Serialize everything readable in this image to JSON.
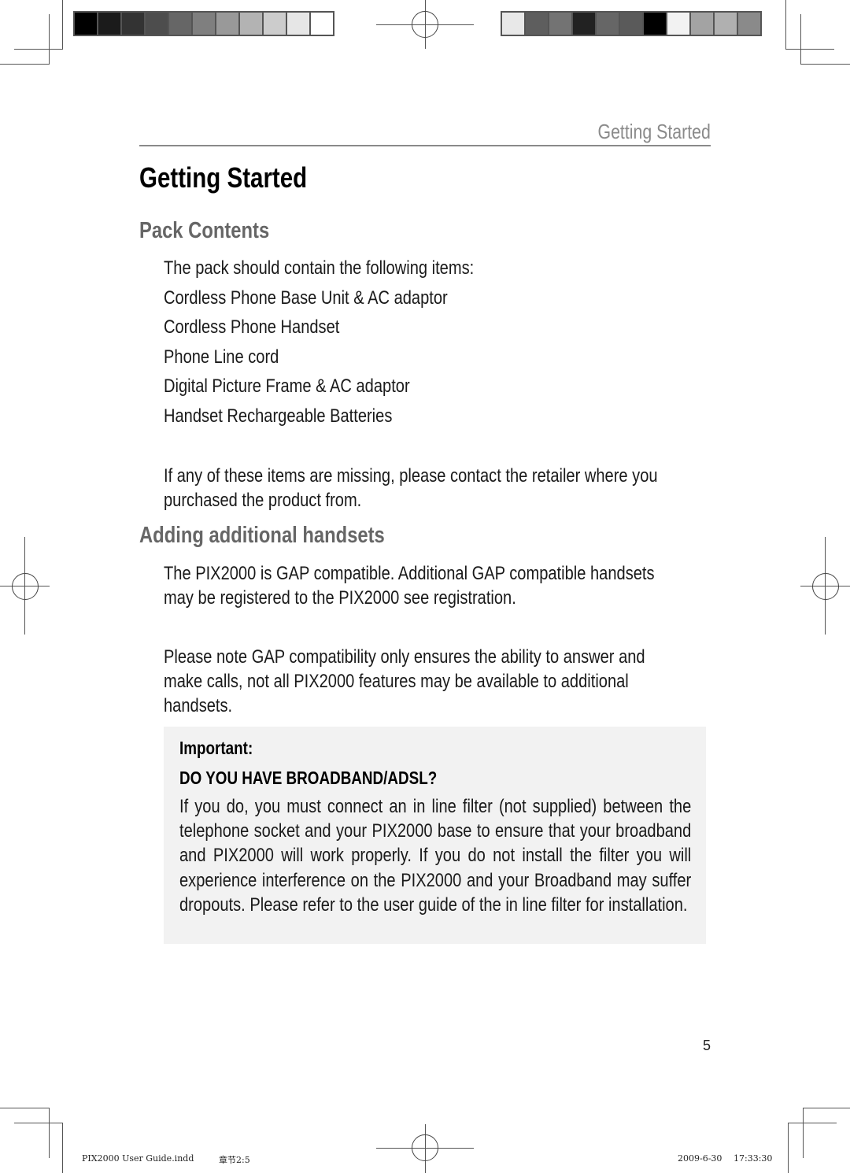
{
  "print_marks": {
    "left_color_bar": [
      "#000000",
      "#1b1b1b",
      "#333333",
      "#4d4d4d",
      "#666666",
      "#7f7f7f",
      "#999999",
      "#b3b3b3",
      "#cccccc",
      "#e6e6e6",
      "#ffffff"
    ],
    "right_color_bar": [
      "#e8e8e8",
      "#5e5e5e",
      "#737373",
      "#222222",
      "#666666",
      "#5a5a5a",
      "#000000",
      "#f2f2f2",
      "#a3a3a3",
      "#b0b0b0",
      "#8a8a8a"
    ],
    "slug_file": "PIX2000 User Guide.indd",
    "slug_section": "章节2:5",
    "slug_date": "2009-6-30",
    "slug_time": "17:33:30"
  },
  "header": {
    "running_head": "Getting Started"
  },
  "page": {
    "title": "Getting Started",
    "sections": [
      {
        "heading": "Pack Contents",
        "intro": "The pack should contain the following items:",
        "items": [
          "Cordless Phone Base Unit & AC adaptor",
          "Cordless Phone Handset",
          "Phone Line cord",
          "Digital Picture Frame & AC adaptor",
          "Handset Rechargeable Batteries"
        ],
        "note": "If any of these items are missing, please contact the retailer where you purchased the product from."
      },
      {
        "heading": "Adding additional handsets",
        "paragraphs": [
          "The PIX2000 is GAP compatible. Additional GAP compatible handsets may be registered to the PIX2000 see registration.",
          "Please note GAP compatibility only ensures the ability to answer and make calls, not all PIX2000 features may be available to additional handsets."
        ]
      }
    ],
    "callout": {
      "label": "Important:",
      "heading": "DO YOU HAVE BROADBAND/ADSL?",
      "body": "If you do, you must connect an in line filter (not supplied) between the telephone socket and your PIX2000 base to ensure that your broadband and PIX2000 will work properly. If you do not install the filter you will experience interference on the PIX2000 and your Broadband may suffer dropouts. Please refer to the user guide of the in line filter for installation."
    },
    "page_number": "5"
  }
}
